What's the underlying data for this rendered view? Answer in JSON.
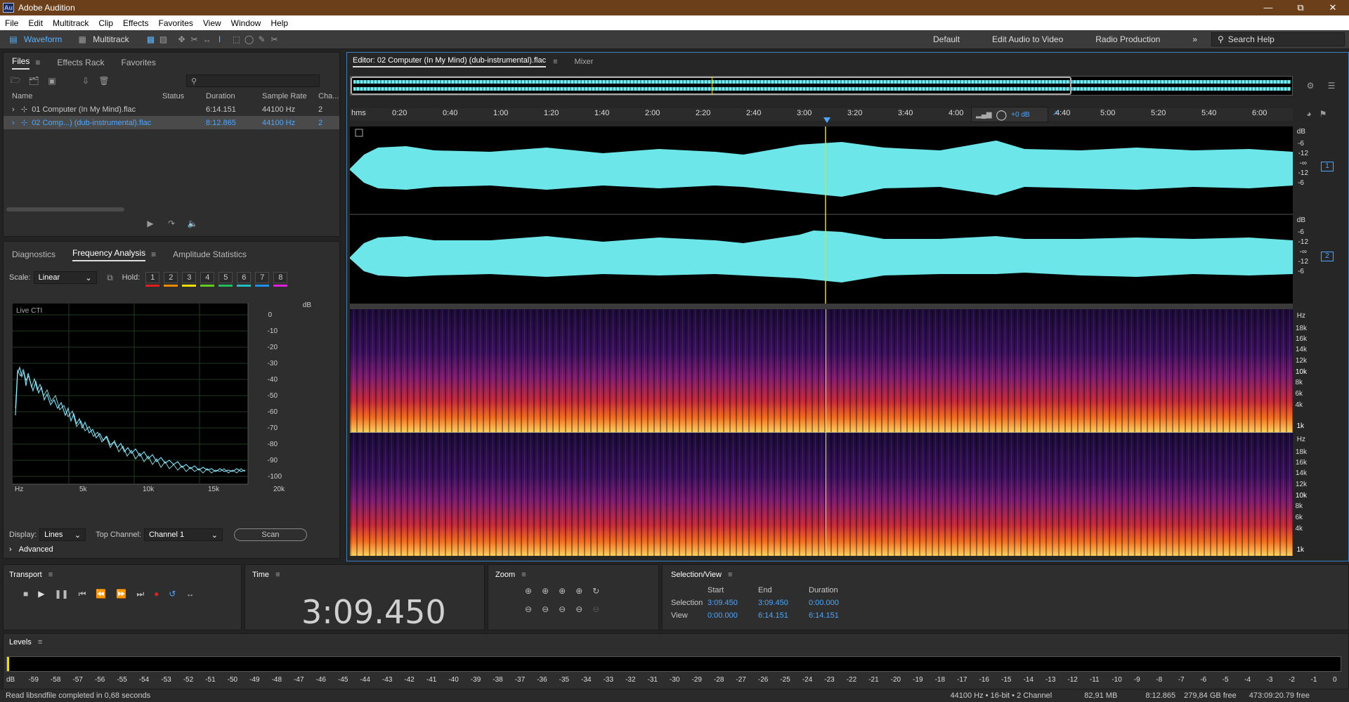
{
  "app": {
    "title": "Adobe Audition",
    "logo": "Au"
  },
  "menu": [
    "File",
    "Edit",
    "Multitrack",
    "Clip",
    "Effects",
    "Favorites",
    "View",
    "Window",
    "Help"
  ],
  "toolbar": {
    "waveform": "Waveform",
    "multitrack": "Multitrack",
    "workspaces": [
      "Default",
      "Edit Audio to Video",
      "Radio Production"
    ],
    "search_placeholder": "Search Help"
  },
  "files_panel": {
    "tabs": [
      "Files",
      "Effects Rack",
      "Favorites"
    ],
    "columns": [
      "Name",
      "Status",
      "Duration",
      "Sample Rate",
      "Cha..."
    ],
    "rows": [
      {
        "name": "01 Computer (In My Mind).flac",
        "status": "",
        "duration": "6:14.151",
        "rate": "44100 Hz",
        "ch": "2"
      },
      {
        "name": "02 Comp...) (dub-instrumental).flac",
        "status": "",
        "duration": "8:12.865",
        "rate": "44100 Hz",
        "ch": "2"
      }
    ]
  },
  "analysis_panel": {
    "tabs": [
      "Diagnostics",
      "Frequency Analysis",
      "Amplitude Statistics"
    ],
    "scale_label": "Scale:",
    "scale_value": "Linear",
    "hold_label": "Hold:",
    "hold": [
      "1",
      "2",
      "3",
      "4",
      "5",
      "6",
      "7",
      "8"
    ],
    "hold_colors": [
      "#e02020",
      "#f08a00",
      "#f0e000",
      "#60d020",
      "#20c060",
      "#20c0c0",
      "#2090f0",
      "#e020e0"
    ],
    "graph_title": "Live CTI",
    "db_labels": [
      "dB",
      "0",
      "-10",
      "-20",
      "-30",
      "-40",
      "-50",
      "-60",
      "-70",
      "-80",
      "-90",
      "-100"
    ],
    "hz_labels": [
      "Hz",
      "5k",
      "10k",
      "15k",
      "20k"
    ],
    "display_label": "Display:",
    "display_value": "Lines",
    "top_channel_label": "Top Channel:",
    "top_channel_value": "Channel 1",
    "scan": "Scan",
    "advanced": "Advanced"
  },
  "editor": {
    "tab": "Editor: 02 Computer (In My Mind) (dub-instrumental).flac",
    "mixer": "Mixer",
    "ruler": [
      "hms",
      "0:20",
      "0:40",
      "1:00",
      "1:20",
      "1:40",
      "2:00",
      "2:20",
      "2:40",
      "3:00",
      "3:20",
      "3:40",
      "4:00",
      "4:40",
      "5:00",
      "5:20",
      "5:40",
      "6:00"
    ],
    "gain": "+0 dB",
    "db_scale": [
      "dB",
      "-6",
      "-12",
      "-∞",
      "-12",
      "-6"
    ],
    "channels": [
      "1",
      "2"
    ],
    "hz_scale": [
      "Hz",
      "18k",
      "16k",
      "14k",
      "12k",
      "10k",
      "8k",
      "6k",
      "4k",
      "1k"
    ]
  },
  "transport": {
    "title": "Transport"
  },
  "time": {
    "title": "Time",
    "value": "3:09.450"
  },
  "zoom": {
    "title": "Zoom"
  },
  "selection": {
    "title": "Selection/View",
    "headers": [
      "Start",
      "End",
      "Duration"
    ],
    "rows": [
      {
        "label": "Selection",
        "start": "3:09.450",
        "end": "3:09.450",
        "duration": "0:00.000"
      },
      {
        "label": "View",
        "start": "0:00.000",
        "end": "6:14.151",
        "duration": "6:14.151"
      }
    ]
  },
  "levels": {
    "title": "Levels",
    "scale": [
      "dB",
      "-59",
      "-58",
      "-57",
      "-56",
      "-55",
      "-54",
      "-53",
      "-52",
      "-51",
      "-50",
      "-49",
      "-48",
      "-47",
      "-46",
      "-45",
      "-44",
      "-43",
      "-42",
      "-41",
      "-40",
      "-39",
      "-38",
      "-37",
      "-36",
      "-35",
      "-34",
      "-33",
      "-32",
      "-31",
      "-30",
      "-29",
      "-28",
      "-27",
      "-26",
      "-25",
      "-24",
      "-23",
      "-22",
      "-21",
      "-20",
      "-19",
      "-18",
      "-17",
      "-16",
      "-15",
      "-14",
      "-13",
      "-12",
      "-11",
      "-10",
      "-9",
      "-8",
      "-7",
      "-6",
      "-5",
      "-4",
      "-3",
      "-2",
      "-1",
      "0"
    ]
  },
  "status": {
    "message": "Read libsndfile completed in 0,68 seconds",
    "format": "44100 Hz • 16-bit • 2 Channel",
    "size": "82,91 MB",
    "duration": "8:12.865",
    "free": "279,84 GB free",
    "free_time": "473:09:20.79 free"
  }
}
